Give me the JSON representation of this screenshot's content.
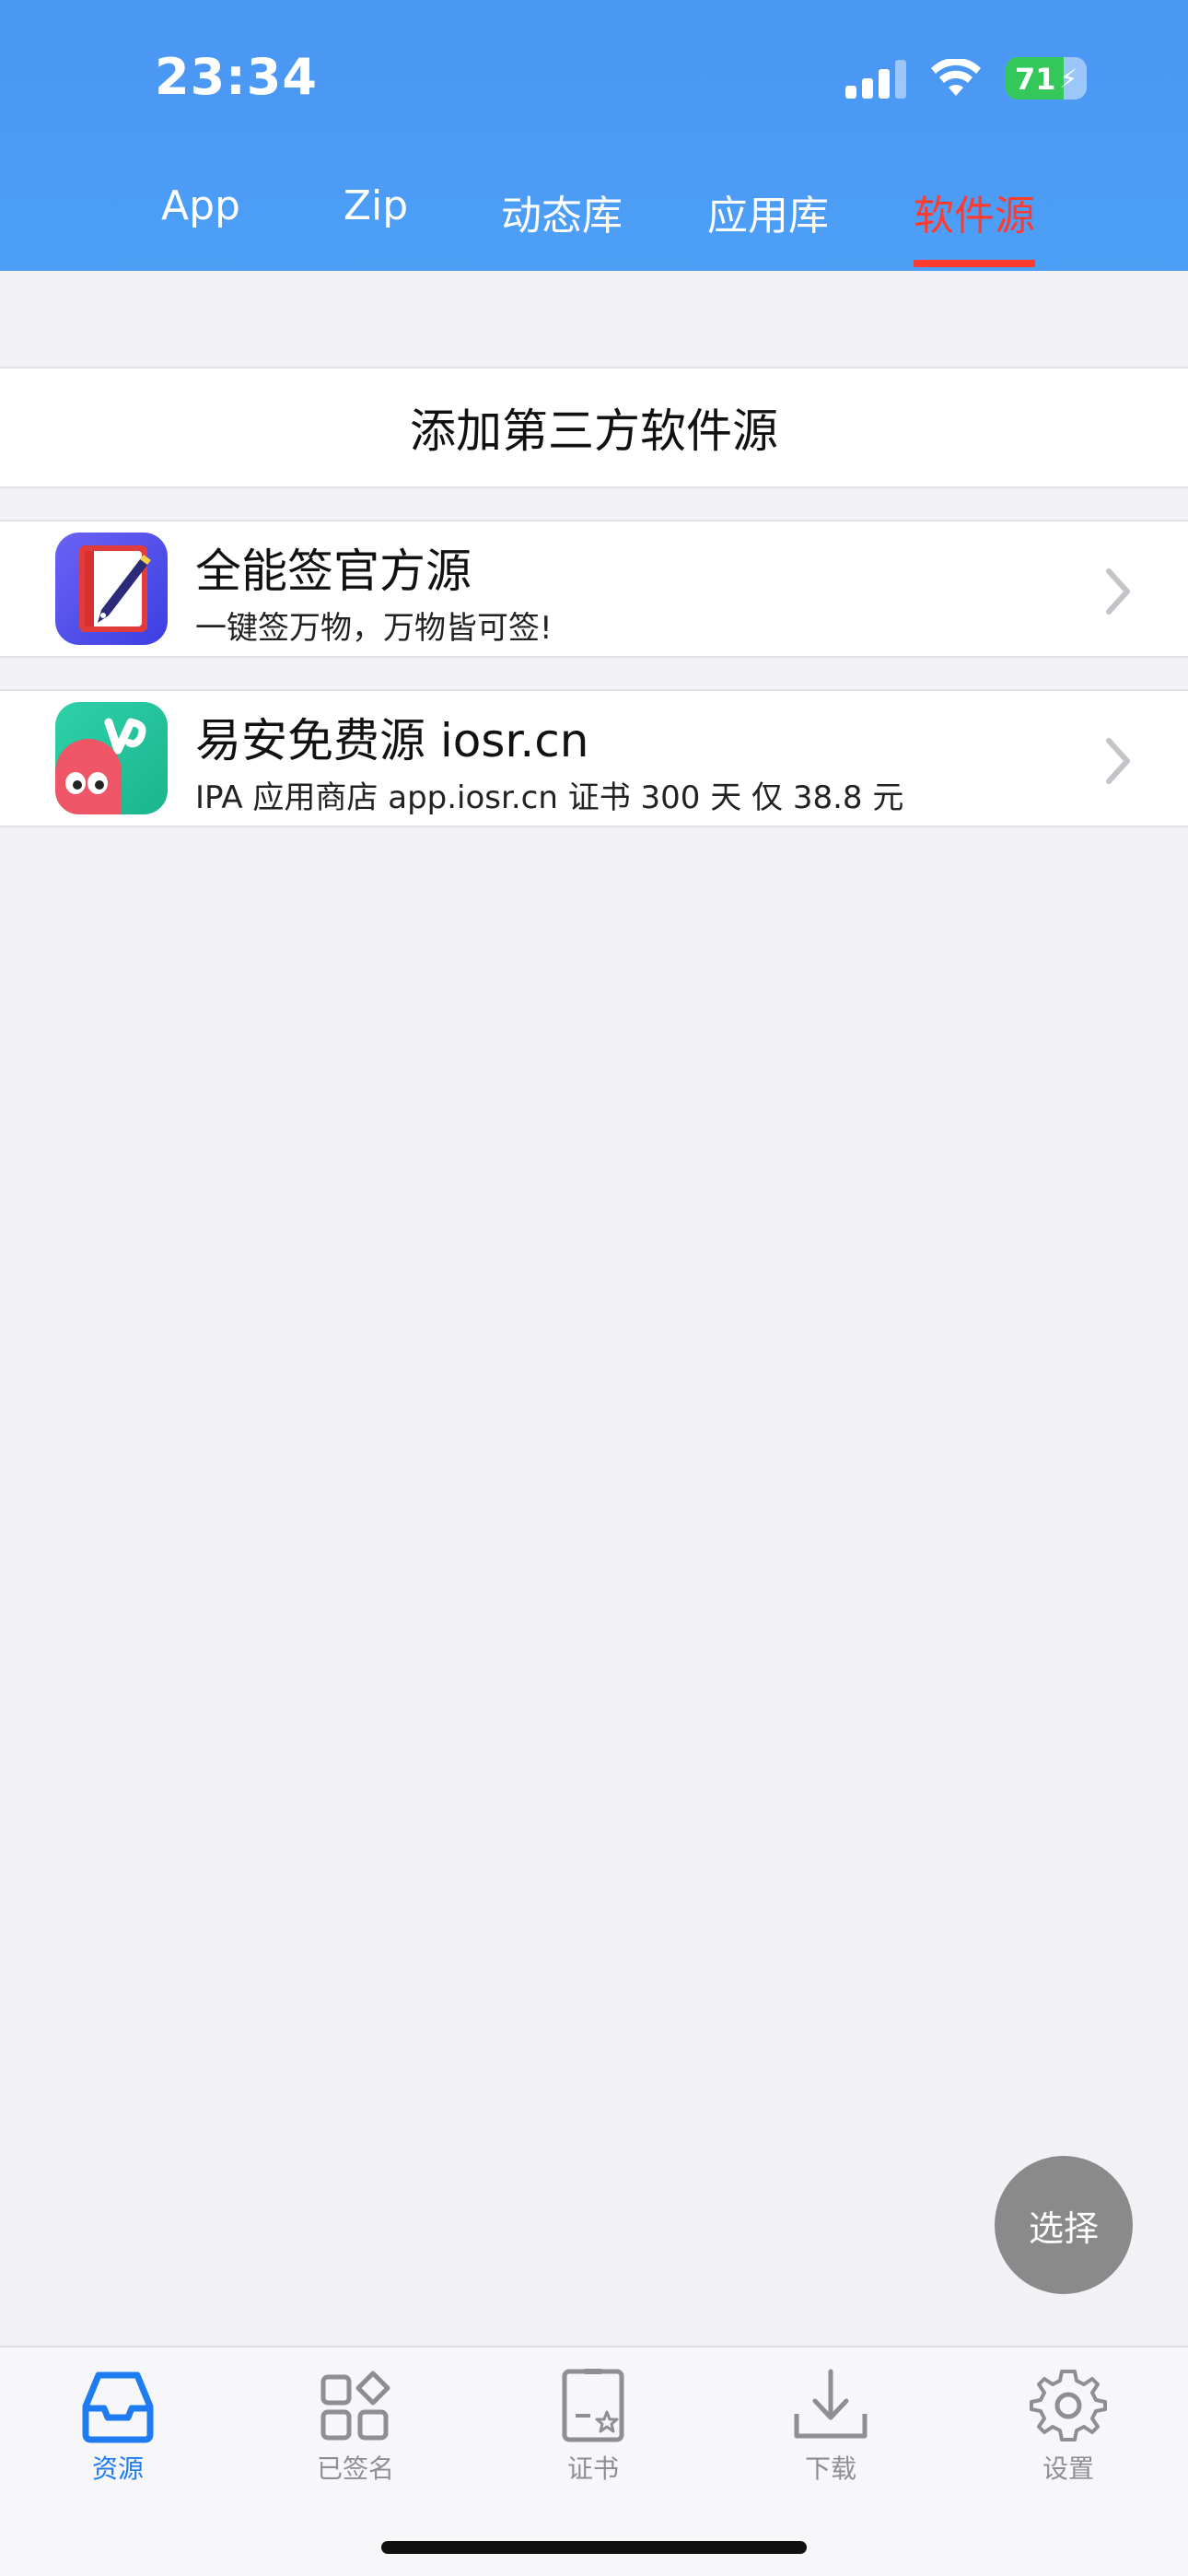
{
  "status_bar": {
    "time": "23:34",
    "battery": "71"
  },
  "top_tabs": [
    {
      "label": "App",
      "active": false
    },
    {
      "label": "Zip",
      "active": false
    },
    {
      "label": "动态库",
      "active": false
    },
    {
      "label": "应用库",
      "active": false
    },
    {
      "label": "软件源",
      "active": true
    }
  ],
  "add_source": {
    "label": "添加第三方软件源"
  },
  "sources": [
    {
      "title": "全能签官方源",
      "subtitle": "一键签万物，万物皆可签!",
      "icon": "pen-book-icon"
    },
    {
      "title": "易安免费源 iosr.cn",
      "subtitle": "IPA 应用商店 app.iosr.cn 证书 300 天 仅 38.8 元",
      "icon": "vine-ghost-icon"
    }
  ],
  "fab": {
    "label": "选择"
  },
  "tab_bar": [
    {
      "label": "资源",
      "icon": "inbox-icon",
      "active": true
    },
    {
      "label": "已签名",
      "icon": "grid-icon",
      "active": false
    },
    {
      "label": "证书",
      "icon": "certificate-icon",
      "active": false
    },
    {
      "label": "下载",
      "icon": "download-icon",
      "active": false
    },
    {
      "label": "设置",
      "icon": "gear-icon",
      "active": false
    }
  ],
  "colors": {
    "header": "#4a96f3",
    "active_tab": "#ff3b30",
    "tabbar_active": "#1e7bf0",
    "background": "#f1f1f6"
  }
}
